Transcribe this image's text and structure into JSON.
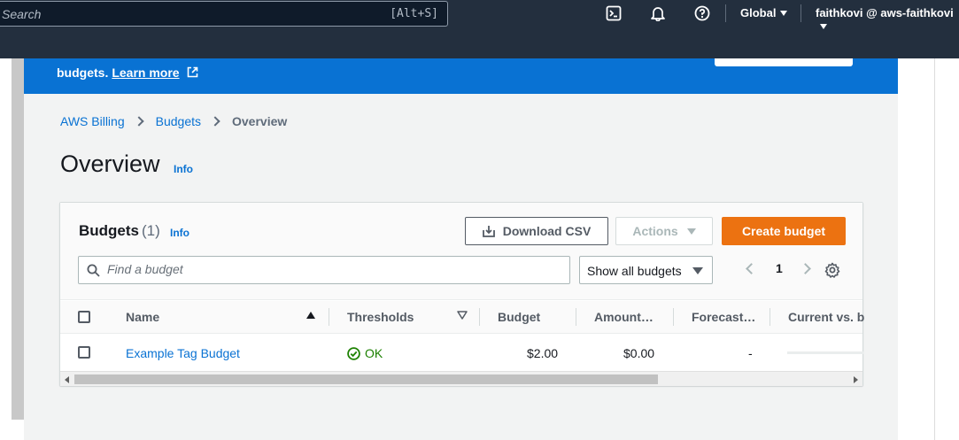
{
  "topnav": {
    "search_placeholder": "Search",
    "search_shortcut": "[Alt+S]",
    "region": "Global",
    "account": "faithkovi @ aws-faithkovi"
  },
  "banner": {
    "text": "budgets.",
    "learn_more": "Learn more"
  },
  "breadcrumb": {
    "items": [
      "AWS Billing",
      "Budgets"
    ],
    "current": "Overview"
  },
  "page": {
    "title": "Overview",
    "info": "Info"
  },
  "budgets": {
    "title": "Budgets",
    "count": "(1)",
    "info": "Info",
    "download_csv": "Download CSV",
    "actions": "Actions",
    "create_budget": "Create budget",
    "search_placeholder": "Find a budget",
    "filter_selected": "Show all budgets",
    "page_number": "1"
  },
  "table": {
    "columns": [
      "Name",
      "Thresholds",
      "Budget",
      "Amount…",
      "Forecast…",
      "Current vs. b"
    ],
    "rows": [
      {
        "name": "Example Tag Budget",
        "thresholds": "OK",
        "budget": "$2.00",
        "amount": "$0.00",
        "forecast": "-"
      }
    ]
  },
  "colors": {
    "nav_bg": "#232f3e",
    "banner_bg": "#0972d3",
    "primary_button": "#ec7211",
    "link": "#0972d3",
    "ok_status": "#1d8102"
  }
}
